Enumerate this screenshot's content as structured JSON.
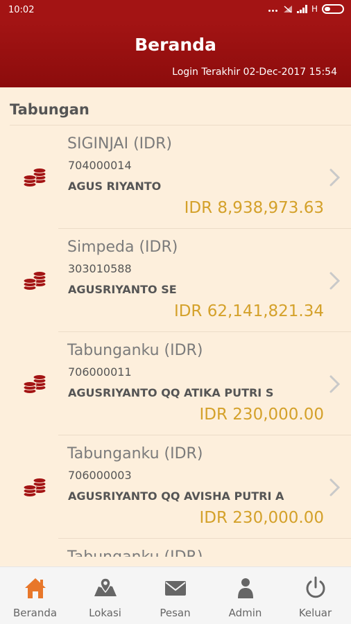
{
  "status_bar": {
    "time": "10:02",
    "network": "H"
  },
  "header": {
    "title": "Beranda",
    "last_login": "Login Terakhir 02-Dec-2017 15:54"
  },
  "section": {
    "title": "Tabungan"
  },
  "accounts": [
    {
      "name": "SIGINJAI (IDR)",
      "number": "704000014",
      "holder": "AGUS RIYANTO",
      "balance": "IDR 8,938,973.63"
    },
    {
      "name": "Simpeda (IDR)",
      "number": "303010588",
      "holder": "AGUSRIYANTO SE",
      "balance": "IDR 62,141,821.34"
    },
    {
      "name": "Tabunganku (IDR)",
      "number": "706000011",
      "holder": "AGUSRIYANTO QQ ATIKA PUTRI S",
      "balance": "IDR 230,000.00"
    },
    {
      "name": "Tabunganku (IDR)",
      "number": "706000003",
      "holder": "AGUSRIYANTO QQ AVISHA PUTRI A",
      "balance": "IDR 230,000.00"
    },
    {
      "name": "Tabunganku (IDR)",
      "number": "",
      "holder": "",
      "balance": ""
    }
  ],
  "tabs": [
    {
      "label": "Beranda",
      "icon": "home-icon",
      "active": true
    },
    {
      "label": "Lokasi",
      "icon": "map-icon",
      "active": false
    },
    {
      "label": "Pesan",
      "icon": "mail-icon",
      "active": false
    },
    {
      "label": "Admin",
      "icon": "user-icon",
      "active": false
    },
    {
      "label": "Keluar",
      "icon": "power-icon",
      "active": false
    }
  ],
  "colors": {
    "header": "#a31414",
    "background": "#fdefdc",
    "amount": "#d4a12a",
    "active_tab": "#e8772a",
    "coin": "#a31414"
  }
}
